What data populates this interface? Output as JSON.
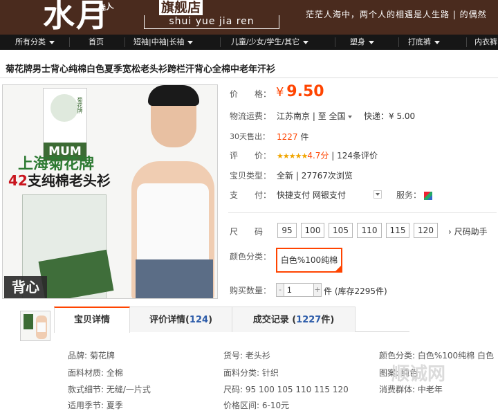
{
  "banner": {
    "logo_main": "水月",
    "logo_small": "佳人",
    "logo_flag": "旗舰店",
    "logo_pinyin": "shui yue jia ren",
    "slogan": "茫茫人海中，两个人的相遇是人生路 | 的偶然"
  },
  "nav": {
    "items": [
      {
        "label": "所有分类",
        "caret": true
      },
      {
        "label": "首页",
        "caret": false
      },
      {
        "label": "短袖|中袖|长袖",
        "caret": true
      },
      {
        "label": "儿童/少女/学生/其它",
        "caret": true
      },
      {
        "label": "塑身",
        "caret": true
      },
      {
        "label": "打底裤",
        "caret": true
      },
      {
        "label": "内衣裤",
        "caret": false
      }
    ]
  },
  "product": {
    "title": "菊花牌男士背心纯棉白色夏季宽松老头衫跨栏汗背心全棉中老年汗衫",
    "image": {
      "mum_label": "MUM",
      "logo_text": "菊花牌",
      "brand_text": "上海菊花牌",
      "sub_count": "42",
      "sub_text": "支纯棉老头衫",
      "badge": "背心"
    },
    "price_label": "价　　格：",
    "price_currency": "¥",
    "price_value": "9.50",
    "shipping_label": "物流运费：",
    "shipping_from": "江苏南京",
    "shipping_to_prefix": "至",
    "shipping_to": "全国",
    "shipping_express": "快递：¥ 5.00",
    "sold_label": "30天售出：",
    "sold_count": "1227",
    "sold_unit": "件",
    "rating_label": "评　　价：",
    "rating_stars": "★★★★★",
    "rating_score": "4.7分",
    "rating_reviews": "124条评价",
    "type_label": "宝贝类型：",
    "type_value": "全新",
    "views": "27767次浏览",
    "pay_label": "支　　付：",
    "pay_quick": "快捷支付",
    "pay_bank": "网银支付",
    "service_label": "服务：",
    "size_label": "尺　　码",
    "sizes": [
      "95",
      "100",
      "105",
      "110",
      "115",
      "120"
    ],
    "size_helper": "尺码助手",
    "color_label": "颜色分类：",
    "color_option": "白色%100纯棉",
    "qty_label": "购买数量：",
    "qty_value": "1",
    "qty_minus": "-",
    "qty_plus": "+",
    "stock_text": "件 (库存2295件)"
  },
  "tabs": {
    "detail": "宝贝详情",
    "reviews_prefix": "评价详情(",
    "reviews_count": "124",
    "reviews_suffix": ")",
    "records_prefix": "成交记录 (",
    "records_count": "1227",
    "records_suffix": "件)"
  },
  "details": {
    "brand": "品牌: 菊花牌",
    "item_no": "货号: 老头衫",
    "color": "颜色分类: 白色%100纯棉 白色",
    "face_material": "面料材质: 全棉",
    "face_class": "面料分类: 针织",
    "pattern": "图案: 纯色",
    "style": "款式细节: 无缝/一片式",
    "size": "尺码: 95 100 105 110 115 120",
    "consumer": "消费群体: 中老年",
    "season": "适用季节: 夏季",
    "price_range": "价格区间: 6-10元"
  },
  "watermark": "顺诚网"
}
